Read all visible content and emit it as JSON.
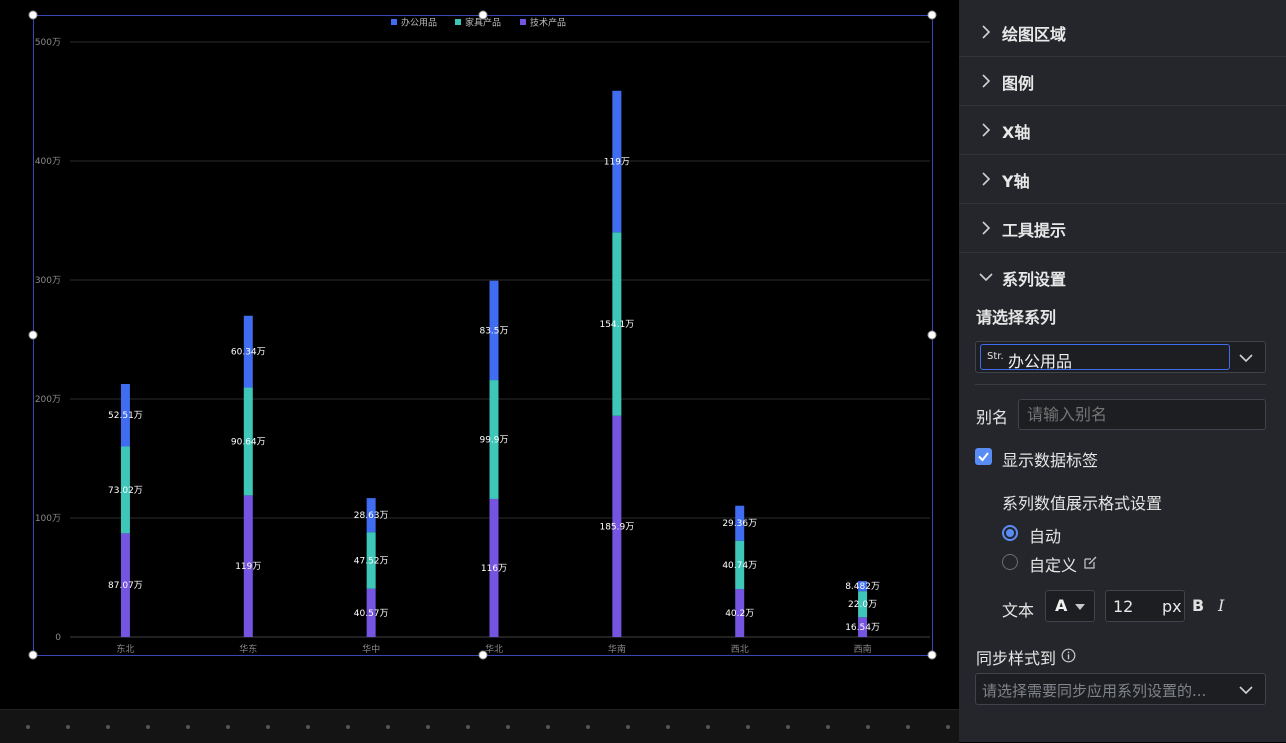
{
  "chart_data": {
    "type": "bar",
    "stacked": true,
    "categories": [
      "东北",
      "华东",
      "华中",
      "华北",
      "华南",
      "西北",
      "西南"
    ],
    "series": [
      {
        "name": "技术产品",
        "color": "#7454e0",
        "values": [
          87.07,
          119,
          40.57,
          116,
          185.9,
          40.2,
          16.54
        ],
        "labels": [
          "87.07万",
          "119万",
          "40.57万",
          "116万",
          "185.9万",
          "40.2万",
          "16.54万"
        ]
      },
      {
        "name": "家具产品",
        "color": "#3ec6b8",
        "values": [
          73.02,
          90.64,
          47.52,
          99.9,
          154.1,
          40.74,
          22.0
        ],
        "labels": [
          "73.02万",
          "90.64万",
          "47.52万",
          "99.9万",
          "154.1万",
          "40.74万",
          "22.0万"
        ]
      },
      {
        "name": "办公用品",
        "color": "#3f6cf0",
        "values": [
          52.51,
          60.34,
          28.63,
          83.5,
          119,
          29.36,
          8.482
        ],
        "labels": [
          "52.51万",
          "60.34万",
          "28.63万",
          "83.5万",
          "119万",
          "29.36万",
          "8.482万"
        ]
      }
    ],
    "legend": [
      "办公用品",
      "家具产品",
      "技术产品"
    ],
    "legend_position": "top-center",
    "ylim": [
      0,
      500
    ],
    "yticks": [
      0,
      100,
      200,
      300,
      400,
      500
    ],
    "ytick_labels": [
      "0",
      "100万",
      "200万",
      "300万",
      "400万",
      "500万"
    ],
    "grid": true
  },
  "panel": {
    "sections": [
      {
        "label": "绘图区域",
        "expanded": false
      },
      {
        "label": "图例",
        "expanded": false
      },
      {
        "label": "X轴",
        "expanded": false
      },
      {
        "label": "Y轴",
        "expanded": false
      },
      {
        "label": "工具提示",
        "expanded": false
      },
      {
        "label": "系列设置",
        "expanded": true
      }
    ],
    "series_select_label": "请选择系列",
    "series_type_badge": "Str.",
    "series_selected": "办公用品",
    "alias_label": "别名",
    "alias_placeholder": "请输入别名",
    "show_labels_text": "显示数据标签",
    "show_labels_checked": true,
    "format_title": "系列数值展示格式设置",
    "format_auto": "自动",
    "format_custom": "自定义",
    "text_label": "文本",
    "font_color_glyph": "A",
    "font_size": "12",
    "font_unit": "px",
    "bold_glyph": "B",
    "italic_glyph": "I",
    "sync_label": "同步样式到",
    "sync_placeholder": "请选择需要同步应用系列设置的...",
    "accent_color": "#3f6cf0"
  }
}
